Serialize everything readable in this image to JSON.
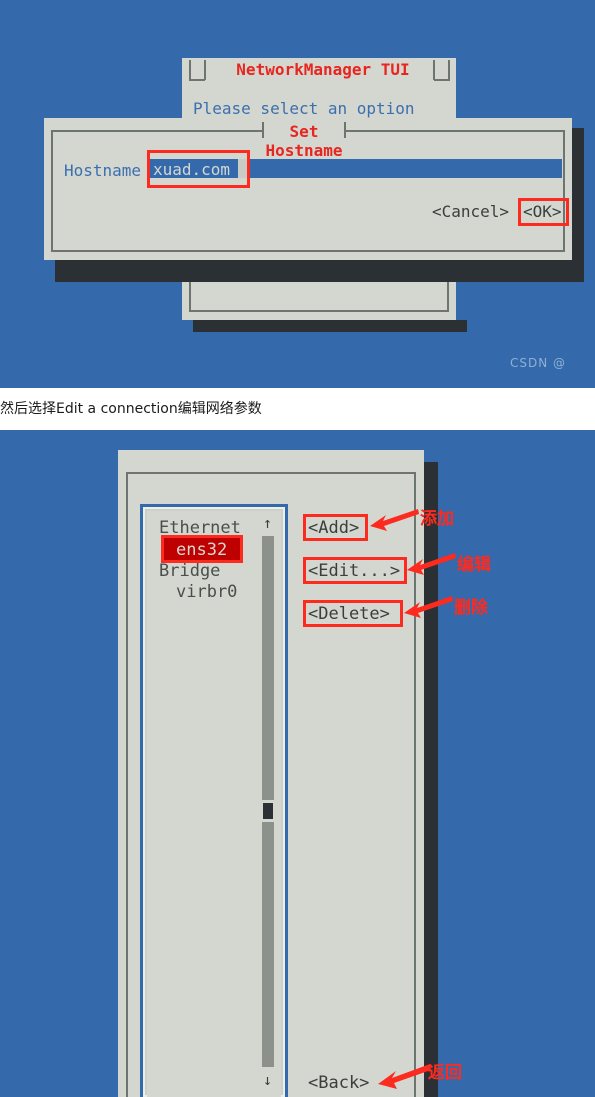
{
  "colors": {
    "terminal_bg": "#3469ab",
    "dialog_bg": "#d4d7d0",
    "dialog_shadow": "#2b3034",
    "title_red": "#e8251e",
    "text_blue": "#3b6fae",
    "text_dark": "#3a3f3c",
    "annotation_red": "#fd2b1f",
    "selection_red": "#bf0000",
    "input_blue": "#3469ab",
    "scrollbar_gray": "#8c918c",
    "list_border_blue": "#3469ab"
  },
  "screenshot1": {
    "window_title": "NetworkManager TUI",
    "prompt": "Please select an option",
    "dialog_title": "Set Hostname",
    "hostname_label": "Hostname",
    "hostname_value": "xuad.com",
    "cancel_label": "<Cancel>",
    "ok_label": "<OK>",
    "watermark": "CSDN @"
  },
  "caption": {
    "text": "然后选择Edit a connection编辑网络参数"
  },
  "screenshot2": {
    "list": [
      {
        "label": "Ethernet",
        "indent": 0,
        "selected": false
      },
      {
        "label": "ens32",
        "indent": 1,
        "selected": true
      },
      {
        "label": "Bridge",
        "indent": 0,
        "selected": false
      },
      {
        "label": "virbr0",
        "indent": 1,
        "selected": false
      }
    ],
    "scroll_up_arrow": "↑",
    "scroll_down_arrow": "↓",
    "buttons": {
      "add": "<Add>",
      "edit": "<Edit...>",
      "delete": "<Delete>",
      "back": "<Back>"
    },
    "annotations": {
      "add": "添加",
      "edit": "编辑",
      "delete": "删除",
      "back": "返回"
    }
  }
}
